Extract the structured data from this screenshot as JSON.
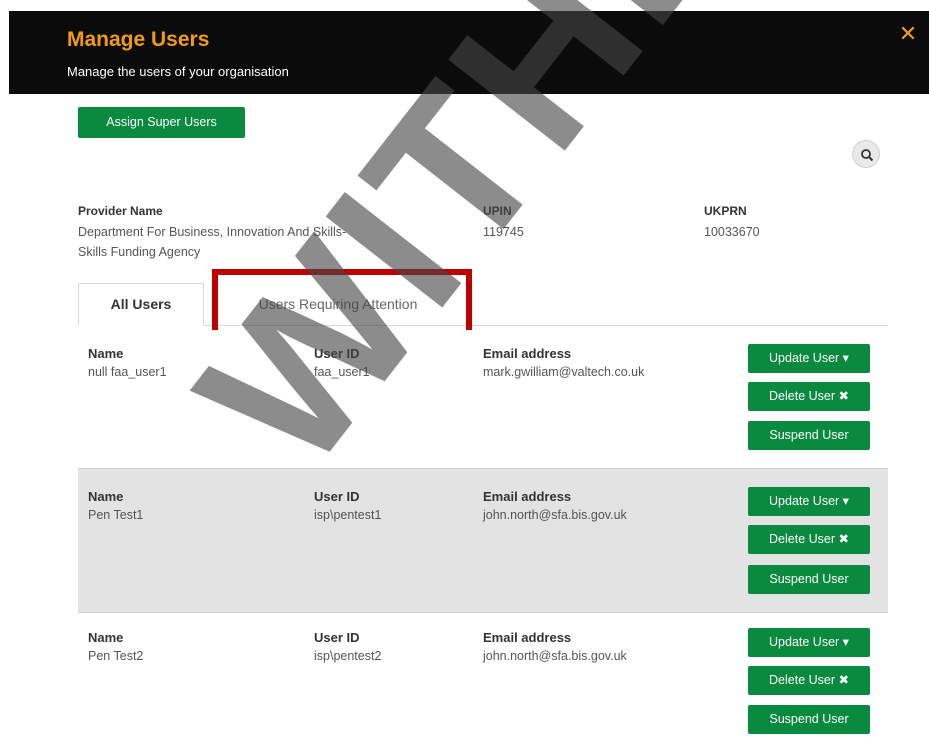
{
  "header": {
    "title": "Manage Users",
    "subtitle": "Manage the users of your organisation",
    "close_icon": "close-icon",
    "accent_color": "#f39c12"
  },
  "toolbar": {
    "assign_label": "Assign Super Users",
    "search_icon": "search-icon"
  },
  "provider": {
    "name_label": "Provider Name",
    "name_value_line1": "Department For Business, Innovation And Skills-",
    "name_value_line2": "Skills Funding Agency",
    "upin_label": "UPIN",
    "upin_value": "119745",
    "ukprn_label": "UKPRN",
    "ukprn_value": "10033670"
  },
  "tabs": [
    {
      "label": "All Users",
      "active": true
    },
    {
      "label": "Users Requiring Attention",
      "active": false
    }
  ],
  "columns": {
    "name": "Name",
    "user_id": "User ID",
    "email": "Email address"
  },
  "users": [
    {
      "name": "null faa_user1",
      "user_id": "faa_user1",
      "email": "mark.gwilliam@valtech.co.uk"
    },
    {
      "name": "Pen Test1",
      "user_id": "isp\\pentest1",
      "email": "john.north@sfa.bis.gov.uk"
    },
    {
      "name": "Pen Test2",
      "user_id": "isp\\pentest2",
      "email": "john.north@sfa.bis.gov.uk"
    }
  ],
  "actions": {
    "update": "Update User ▾",
    "delete": "Delete User ✖",
    "suspend": "Suspend User"
  },
  "watermark": "WITHDRAWN",
  "colors": {
    "button_green": "#0a8a3e",
    "highlight_red": "#c00000",
    "header_bg": "#0b0b0b"
  }
}
